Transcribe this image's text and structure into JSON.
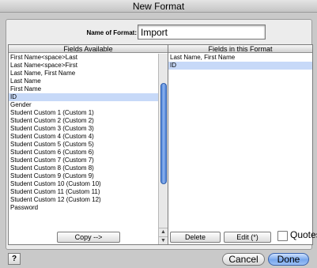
{
  "window": {
    "title": "New Format"
  },
  "name_field": {
    "label": "Name of Format:",
    "value": "Import"
  },
  "fields_available": {
    "header": "Fields Available",
    "selected_index": 5,
    "items": [
      "First Name<space>Last",
      "Last Name<space>First",
      "Last Name, First Name",
      "Last Name",
      "First Name",
      "ID",
      "Gender",
      "Student Custom 1 (Custom 1)",
      "Student Custom 2 (Custom 2)",
      "Student Custom 3 (Custom 3)",
      "Student Custom 4 (Custom 4)",
      "Student Custom 5 (Custom 5)",
      "Student Custom 6 (Custom 6)",
      "Student Custom 7 (Custom 7)",
      "Student Custom 8 (Custom 8)",
      "Student Custom 9 (Custom 9)",
      "Student Custom 10 (Custom 10)",
      "Student Custom 11 (Custom 11)",
      "Student Custom 12 (Custom 12)",
      "Password"
    ]
  },
  "fields_in_format": {
    "header": "Fields in this Format",
    "selected_index": 1,
    "items": [
      "Last Name, First Name",
      "ID"
    ]
  },
  "buttons": {
    "copy": "Copy -->",
    "delete": "Delete",
    "edit": "Edit (*)",
    "quotes": "Quotes",
    "help": "?",
    "cancel": "Cancel",
    "done": "Done"
  },
  "quotes_checked": false
}
